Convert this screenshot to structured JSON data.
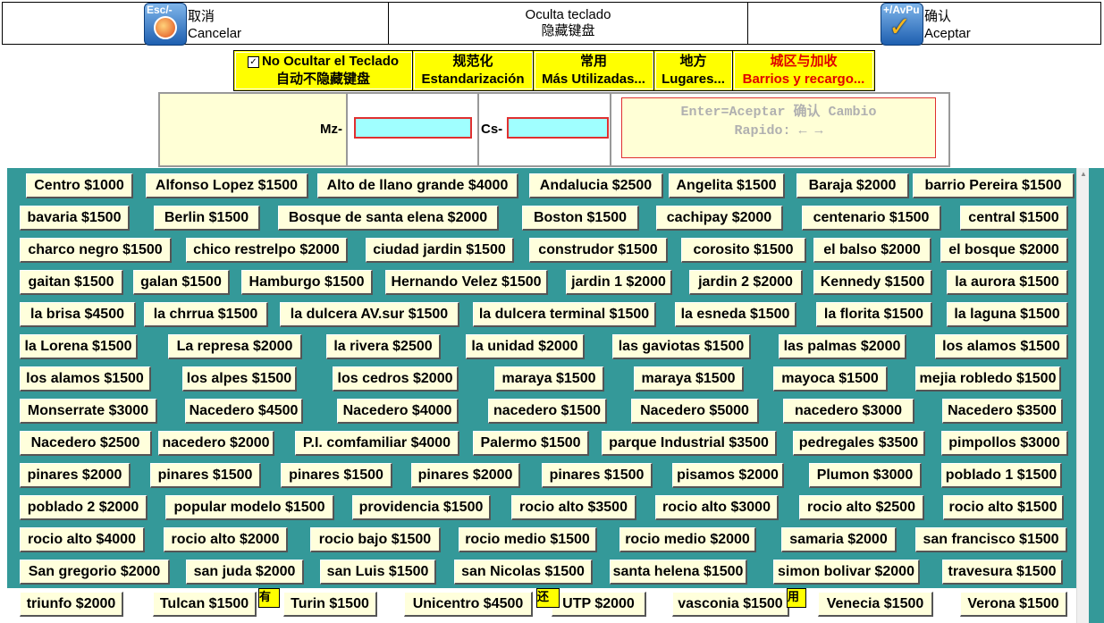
{
  "toolbar": {
    "cancel": {
      "key": "Esc/-",
      "zh": "取消",
      "es": "Cancelar"
    },
    "hide": {
      "es": "Oculta teclado",
      "zh": "隐藏键盘"
    },
    "accept": {
      "key": "+/AvPu",
      "zh": "确认",
      "es": "Aceptar"
    }
  },
  "tabs": [
    {
      "line1": "No Ocultar el Teclado",
      "line2": "自动不隐藏键盘",
      "checked": true
    },
    {
      "line1": "规范化",
      "line2": "Estandarización"
    },
    {
      "line1": "常用",
      "line2": "Más Utilizadas..."
    },
    {
      "line1": "地方",
      "line2": "Lugares..."
    },
    {
      "line1": "城区与加收",
      "line2": "Barrios y recargo..."
    }
  ],
  "inputs": {
    "mz_label": "Mz-",
    "cs_label": "Cs-",
    "mz_value": "",
    "cs_value": "",
    "hint_line1": "Enter=Aceptar 确认  Cambio",
    "hint_line2": "Rapido: ← →"
  },
  "neighborhoods": [
    [
      "Centro $1000",
      "Alfonso Lopez $1500",
      "Alto de llano grande $4000",
      "Andalucia $2500",
      "Angelita $1500",
      "Baraja $2000",
      "barrio Pereira $1500"
    ],
    [
      "bavaria $1500",
      "Berlin $1500",
      "Bosque de santa elena $2000",
      "Boston $1500",
      "cachipay $2000",
      "centenario $1500",
      "central $1500"
    ],
    [
      "charco negro $1500",
      "chico restrelpo $2000",
      "ciudad jardin $1500",
      "construdor $1500",
      "corosito $1500",
      "el balso $2000",
      "el bosque $2000"
    ],
    [
      "gaitan $1500",
      "galan $1500",
      "Hamburgo $1500",
      "Hernando Velez $1500",
      "jardin 1 $2000",
      "jardin 2 $2000",
      "Kennedy $1500",
      "la aurora $1500"
    ],
    [
      "la brisa $4500",
      "la chrrua $1500",
      "la dulcera AV.sur $1500",
      "la dulcera terminal $1500",
      "la esneda $1500",
      "la florita $1500",
      "la laguna $1500"
    ],
    [
      "la Lorena $1500",
      "La represa $2000",
      "la rivera $2500",
      "la unidad $2000",
      "las gaviotas $1500",
      "las palmas $2000",
      "los alamos $1500"
    ],
    [
      "los alamos $1500",
      "los alpes $1500",
      "los cedros $2000",
      "maraya $1500",
      "maraya $1500",
      "mayoca $1500",
      "mejia robledo $1500"
    ],
    [
      "Monserrate $3000",
      "Nacedero $4500",
      "Nacedero $4000",
      "nacedero $1500",
      "Nacedero $5000",
      "nacedero $3000",
      "Nacedero $3500"
    ],
    [
      "Nacedero $2500",
      "nacedero $2000",
      "P.I. comfamiliar $4000",
      "Palermo $1500",
      "parque Industrial $3500",
      "pedregales $3500",
      "pimpollos $3000"
    ],
    [
      "pinares $2000",
      "pinares $1500",
      "pinares $1500",
      "pinares $2000",
      "pinares $1500",
      "pisamos $2000",
      "Plumon $3000",
      "poblado 1 $1500"
    ],
    [
      "poblado 2 $2000",
      "popular modelo $1500",
      "providencia $1500",
      "rocio alto $3500",
      "rocio alto $3000",
      "rocio alto $2500",
      "rocio alto $1500"
    ],
    [
      "rocio alto $4000",
      "rocio alto $2000",
      "rocio bajo $1500",
      "rocio medio $1500",
      "rocio medio $2000",
      "samaria $2000",
      "san francisco $1500"
    ],
    [
      "San gregorio $2000",
      "san juda $2000",
      "san Luis $1500",
      "san Nicolas $1500",
      "santa helena $1500",
      "simon bolivar $2000",
      "travesura $1500"
    ],
    [
      "triunfo $2000",
      "Tulcan $1500",
      "Turin $1500",
      "Unicentro $4500",
      "UTP $2000",
      "vasconia $1500",
      "Venecia $1500",
      "Verona $1500"
    ]
  ],
  "partial_labels": [
    "有",
    "还",
    "用"
  ],
  "colors": {
    "teal": "#349999",
    "button": "#ffffdc",
    "tab": "#ffff00",
    "input": "#a0ffff",
    "accent_red": "#e00000"
  }
}
